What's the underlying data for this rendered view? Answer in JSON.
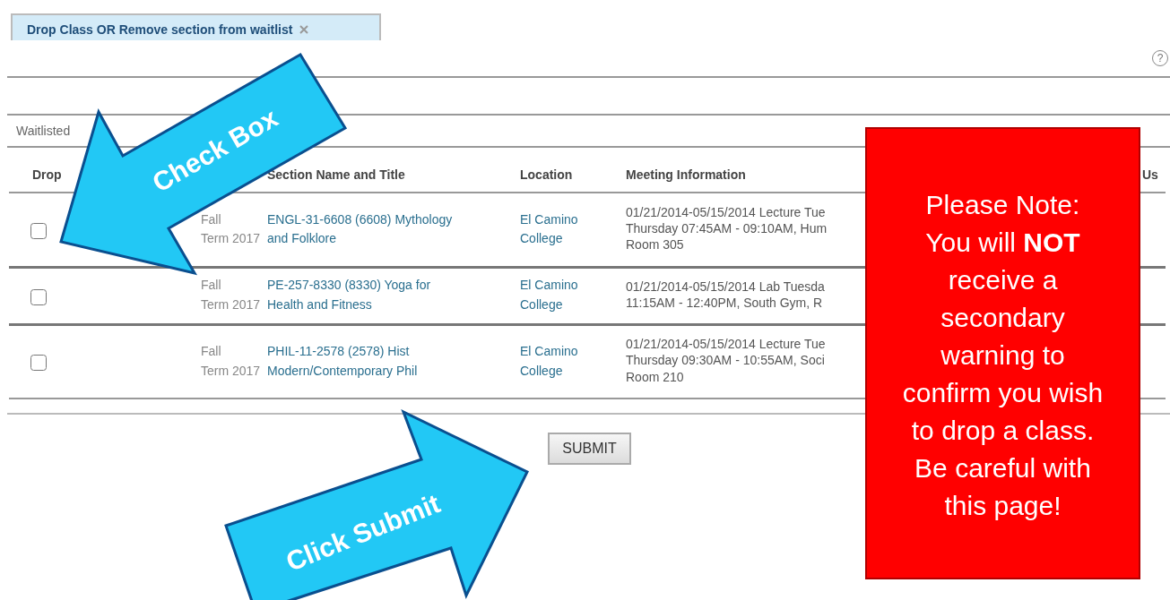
{
  "tab": {
    "label": "Drop Class OR Remove section from waitlist"
  },
  "help": "?",
  "section_label": "Waitlisted",
  "table": {
    "columns": {
      "drop": "Drop",
      "section": "Section Name and Title",
      "location": "Location",
      "meeting": "Meeting Information",
      "column_6": "Us"
    },
    "rows": [
      {
        "checked": false,
        "term": [
          "Fall",
          "Term 2017"
        ],
        "section": [
          "ENGL-31-6608 (6608) Mythology",
          "and Folklore"
        ],
        "location": [
          "El Camino",
          "College"
        ],
        "meeting": [
          "01/21/2014-05/15/2014 Lecture Tue",
          "Thursday 07:45AM - 09:10AM, Hum",
          "Room 305"
        ]
      },
      {
        "checked": false,
        "term": [
          "Fall",
          "Term 2017"
        ],
        "section": [
          "PE-257-8330 (8330) Yoga for",
          "Health and Fitness"
        ],
        "location": [
          "El Camino",
          "College"
        ],
        "meeting": [
          "01/21/2014-05/15/2014 Lab Tuesda",
          "11:15AM - 12:40PM, South Gym, R"
        ]
      },
      {
        "checked": false,
        "term": [
          "Fall",
          "Term 2017"
        ],
        "section": [
          "PHIL-11-2578 (2578) Hist",
          "Modern/Contemporary Phil"
        ],
        "location": [
          "El Camino",
          "College"
        ],
        "meeting": [
          "01/21/2014-05/15/2014 Lecture Tue",
          "Thursday 09:30AM - 10:55AM, Soci",
          "Room 210"
        ]
      }
    ]
  },
  "submit": "SUBMIT",
  "annotations": {
    "check_arrow": "Check Box",
    "submit_arrow": "Click Submit",
    "note": "Please Note:\nYou will **NOT**\nreceive a\nsecondary\nwarning to\nconfirm you wish\nto drop a class.\nBe careful with\nthis page!"
  }
}
